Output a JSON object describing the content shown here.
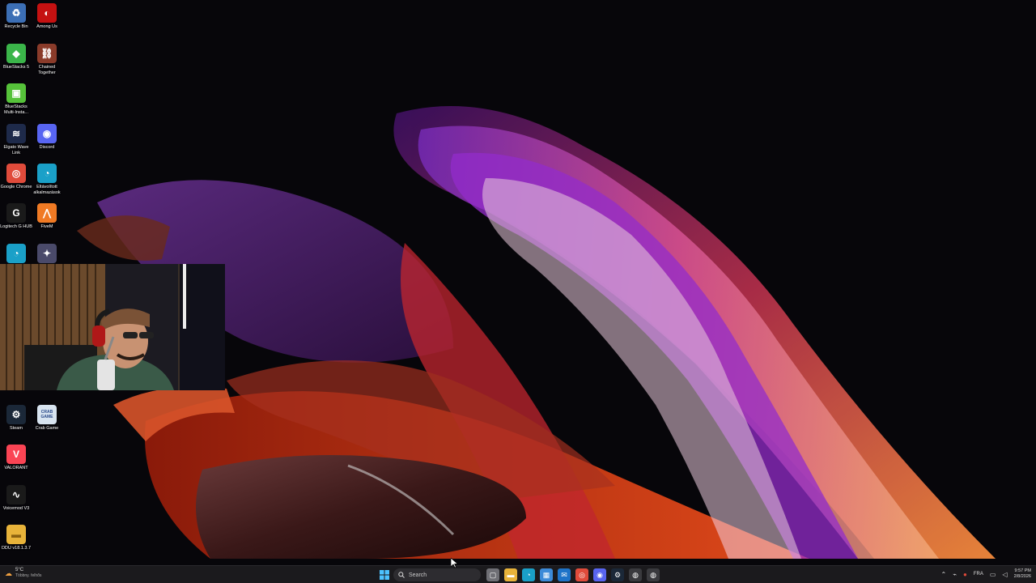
{
  "desktop": {
    "icons": [
      {
        "label": "Recycle Bin",
        "icon": "recycle-bin-icon",
        "color": "#3c6fb5"
      },
      {
        "label": "Among Us",
        "icon": "among-us-icon",
        "color": "#c51111"
      },
      {
        "label": "BlueStacks 5",
        "icon": "bluestacks-icon",
        "color": "#3bb54a"
      },
      {
        "label": "Chained Together",
        "icon": "chained-together-icon",
        "color": "#8a3b2a"
      },
      {
        "label": "BlueStacks Multi-Insta...",
        "icon": "bluestacks-multi-icon",
        "color": "#56c23a"
      },
      {
        "label": "Elgato Wave Link",
        "icon": "elgato-wave-link-icon",
        "color": "#1e2a4a"
      },
      {
        "label": "Discord",
        "icon": "discord-icon",
        "color": "#5865f2"
      },
      {
        "label": "Google Chrome",
        "icon": "chrome-icon",
        "color": "#e04b3b"
      },
      {
        "label": "Eltávolított alkalmazások",
        "icon": "edge-icon",
        "color": "#1aa0c8"
      },
      {
        "label": "Logitech G HUB",
        "icon": "logitech-g-hub-icon",
        "color": "#1a1a1a"
      },
      {
        "label": "FiveM",
        "icon": "fivem-icon",
        "color": "#f07a24"
      },
      {
        "label": "",
        "icon": "edge-icon",
        "color": "#1aa0c8"
      },
      {
        "label": "",
        "icon": "game-icon",
        "color": "#4a4a6a"
      },
      {
        "label": "Steam",
        "icon": "steam-icon",
        "color": "#1b2838"
      },
      {
        "label": "Crab Game",
        "icon": "crab-game-icon",
        "color": "#d8e4f0"
      },
      {
        "label": "VALORANT",
        "icon": "valorant-icon",
        "color": "#fa4454"
      },
      {
        "label": "Voicemod V3",
        "icon": "voicemod-icon",
        "color": "#1a1a1a"
      },
      {
        "label": "DDU v18.1.3.7",
        "icon": "folder-icon",
        "color": "#e8b33a"
      }
    ],
    "crab_game_icon_text": "CRAB GAME"
  },
  "taskbar": {
    "weather_temp": "5°C",
    "weather_desc": "Többny. felhős",
    "search_placeholder": "Search",
    "pinned": [
      {
        "icon": "task-view-icon",
        "color": "#6f6f75"
      },
      {
        "icon": "file-explorer-icon",
        "color": "#e8b33a"
      },
      {
        "icon": "edge-icon",
        "color": "#1aa0c8"
      },
      {
        "icon": "store-icon",
        "color": "#3c8ad8"
      },
      {
        "icon": "outlook-icon",
        "color": "#1e73c8"
      },
      {
        "icon": "chrome-icon",
        "color": "#e04b3b"
      },
      {
        "icon": "discord-icon",
        "color": "#5865f2"
      },
      {
        "icon": "steam-icon",
        "color": "#1b2838"
      },
      {
        "icon": "app-icon",
        "color": "#3a3a3e"
      },
      {
        "icon": "app-icon",
        "color": "#3a3a3e"
      }
    ],
    "language": "FRA",
    "time": "9:57 PM",
    "date": "2/8/2026"
  }
}
